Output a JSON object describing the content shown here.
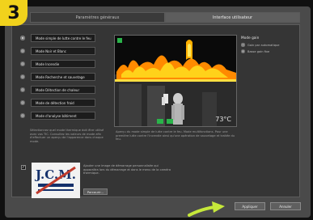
{
  "step_number": "3",
  "tabs": [
    {
      "label": "Paramètres généraux",
      "active": false
    },
    {
      "label": "Interface utilisateur",
      "active": true
    }
  ],
  "modes": [
    {
      "label": "Mode simple de lutte contre le feu",
      "selected": true
    },
    {
      "label": "Mode Noir et Blanc",
      "selected": false
    },
    {
      "label": "Mode Incendie",
      "selected": false
    },
    {
      "label": "Mode Recherche et sauvetage",
      "selected": false
    },
    {
      "label": "Mode Détection de chaleur",
      "selected": false
    },
    {
      "label": "Mode de détection froid",
      "selected": false
    },
    {
      "label": "Mode d'analyse bâtiment",
      "selected": false
    }
  ],
  "desc_left": "Sélectionnez quel mode thermique doit être utilisé avec vos TIC. Consultez les valeurs de mode afin d'effectuer un aperçu de l'apparence dans chaque mode.",
  "desc_right": "Aperçu du mode simple de lutte contre le feu. Mode multifonctions. Pour une première lutte contre l'incendie ainsi qu'une opération de sauvetage et traitée du feu.",
  "camera": {
    "temperature": "73°C"
  },
  "gain": {
    "title": "Mode gain",
    "options": [
      {
        "label": "Gain par automatique",
        "selected": true
      },
      {
        "label": "Basse gain fixe",
        "selected": false
      }
    ]
  },
  "startup_logo": {
    "checked": true,
    "logo_text": "J.C.M.",
    "description": "Ajouter une image de démarrage personnalisée qui apparaîtra lors du démarrage et dans le menu de la caméra thermique.",
    "browse_label": "Parcourir..."
  },
  "footer": {
    "apply_label": "Appliquer",
    "cancel_label": "Annuler"
  },
  "colors": {
    "badge": "#f1d21c",
    "arrow": "#c6e83a",
    "flame": "#ffb000"
  }
}
